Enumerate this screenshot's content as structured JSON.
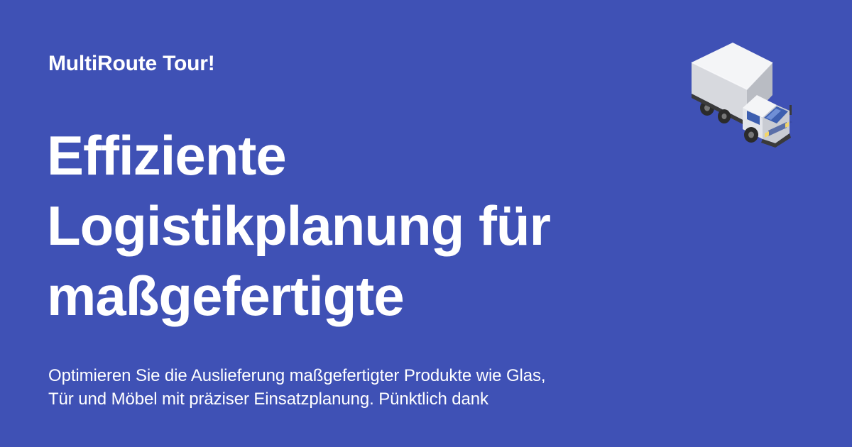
{
  "brand": {
    "name": "MultiRoute Tour!"
  },
  "headline": {
    "lines": [
      "Effiziente",
      "Logistikplanung für",
      "maßgefertigte"
    ]
  },
  "description": {
    "lines": [
      "Optimieren Sie die Auslieferung maßgefertigter Produkte wie Glas,",
      "Tür und Möbel mit präziser Einsatzplanung. Pünktlich dank"
    ]
  },
  "illustration": {
    "icon": "delivery-truck-icon"
  },
  "colors": {
    "background": "#3f51b5",
    "text": "#ffffff"
  }
}
